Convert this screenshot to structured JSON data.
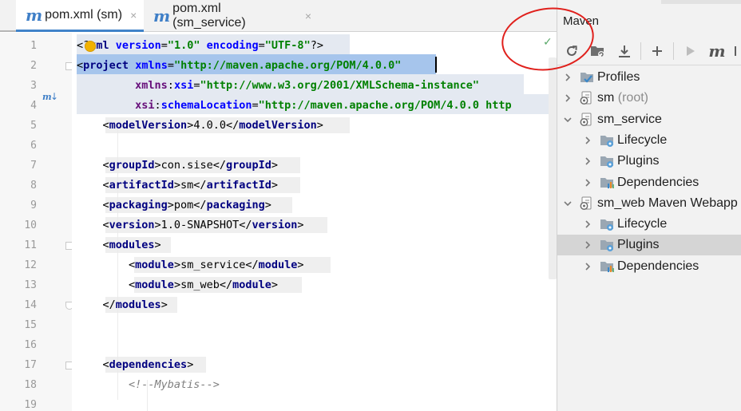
{
  "tabs": [
    {
      "label": "pom.xml (sm)",
      "icon": "maven-m-icon",
      "active": true,
      "close": "×"
    },
    {
      "label": "pom.xml (sm_service)",
      "icon": "maven-m-icon",
      "active": false,
      "close": "×"
    }
  ],
  "tab_icon_glyph": "m",
  "editor": {
    "line_numbers": [
      "1",
      "2",
      "3",
      "4",
      "5",
      "6",
      "7",
      "8",
      "9",
      "10",
      "11",
      "12",
      "13",
      "14",
      "15",
      "16",
      "17",
      "18",
      "19"
    ],
    "lines": [
      "<?xml version=\"1.0\" encoding=\"UTF-8\"?>",
      "<project xmlns=\"http://maven.apache.org/POM/4.0.0\"",
      "         xmlns:xsi=\"http://www.w3.org/2001/XMLSchema-instance\"",
      "         xsi:schemaLocation=\"http://maven.apache.org/POM/4.0.0 http",
      "    <modelVersion>4.0.0</modelVersion>",
      "",
      "    <groupId>con.sise</groupId>",
      "    <artifactId>sm</artifactId>",
      "    <packaging>pom</packaging>",
      "    <version>1.0-SNAPSHOT</version>",
      "    <modules>",
      "        <module>sm_service</module>",
      "        <module>sm_web</module>",
      "    </modules>",
      "",
      "",
      "    <dependencies>",
      "        <!--Mybatis-->",
      ""
    ],
    "gutter_marker": "m↓"
  },
  "maven_panel": {
    "title": "Maven",
    "toolbar": [
      "reload-icon",
      "folder-add-icon",
      "download-icon",
      "plus-icon",
      "run-icon",
      "maven-goal-icon"
    ],
    "toolbar_glyphs": {
      "reload": "⟳",
      "download": "⤓",
      "plus": "+",
      "run": "▶",
      "maven": "m"
    },
    "tree": [
      {
        "label": "Profiles",
        "suffix": "",
        "depth": 0,
        "icon": "profiles-icon",
        "expanded": false
      },
      {
        "label": "sm",
        "suffix": " (root)",
        "depth": 0,
        "icon": "maven-module-icon",
        "expanded": false
      },
      {
        "label": "sm_service",
        "suffix": "",
        "depth": 0,
        "icon": "maven-module-icon",
        "expanded": true
      },
      {
        "label": "Lifecycle",
        "suffix": "",
        "depth": 1,
        "icon": "lifecycle-folder-icon",
        "expanded": false
      },
      {
        "label": "Plugins",
        "suffix": "",
        "depth": 1,
        "icon": "plugins-folder-icon",
        "expanded": false
      },
      {
        "label": "Dependencies",
        "suffix": "",
        "depth": 1,
        "icon": "dependencies-folder-icon",
        "expanded": false
      },
      {
        "label": "sm_web Maven Webapp",
        "suffix": "",
        "depth": 0,
        "icon": "maven-module-icon",
        "expanded": true
      },
      {
        "label": "Lifecycle",
        "suffix": "",
        "depth": 1,
        "icon": "lifecycle-folder-icon",
        "expanded": false
      },
      {
        "label": "Plugins",
        "suffix": "",
        "depth": 1,
        "icon": "plugins-folder-icon",
        "expanded": false,
        "selected": true
      },
      {
        "label": "Dependencies",
        "suffix": "",
        "depth": 1,
        "icon": "dependencies-folder-icon",
        "expanded": false
      }
    ]
  },
  "colors": {
    "accent": "#4083c9",
    "xml_tag": "#000080",
    "xml_attr": "#0000ff",
    "xml_value": "#008000",
    "annotation": "#e0201c"
  }
}
